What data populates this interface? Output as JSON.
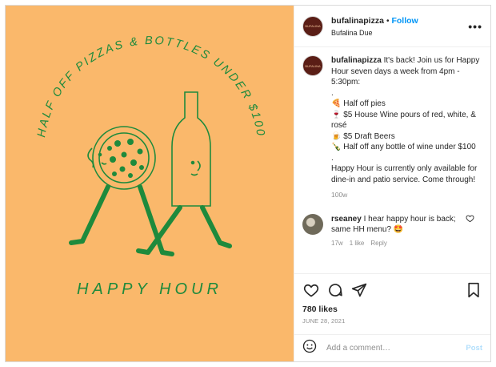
{
  "image": {
    "arc_text": "HALF OFF PIZZAS & BOTTLES UNDER $100",
    "title": "HAPPY HOUR",
    "background": "#fab86b",
    "ink": "#1e8a3c"
  },
  "header": {
    "avatar_text": "BUFALINA",
    "username": "bufalinapizza",
    "dot": "•",
    "follow_label": "Follow",
    "location": "Bufalina Due"
  },
  "caption": {
    "avatar_text": "BUFALINA",
    "username": "bufalinapizza",
    "line1": "It's back! Join us for Happy Hour seven days a week from 4pm - 5:30pm:",
    "sep1": ".",
    "item1": "🍕 Half off pies",
    "item2": "🍷 $5 House Wine pours of red, white, & rosé",
    "item3": "🍺 $5 Draft Beers",
    "item4": "🍾 Half off any bottle of wine under $100",
    "sep2": ".",
    "line2": "Happy Hour is currently only available for dine-in and patio service. Come through!",
    "age": "100w"
  },
  "comment": {
    "username": "rseaney",
    "text": "I hear happy hour is back; same HH menu? 🤩",
    "age": "17w",
    "likes": "1 like",
    "reply": "Reply"
  },
  "actions": {
    "likes": "780 likes",
    "date": "JUNE 28, 2021"
  },
  "add_comment": {
    "placeholder": "Add a comment…",
    "post_label": "Post"
  },
  "icons": [
    "more-icon",
    "heart-icon",
    "comment-icon",
    "share-icon",
    "bookmark-icon",
    "emoji-icon"
  ]
}
